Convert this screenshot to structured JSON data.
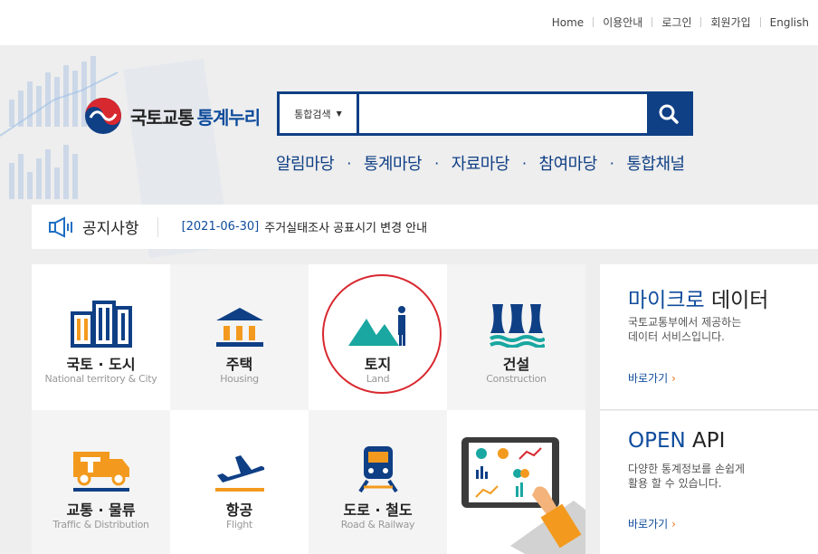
{
  "topnav": {
    "items": [
      "Home",
      "이용안내",
      "로그인",
      "회원가입",
      "English"
    ]
  },
  "logo": {
    "text_prefix": "국토교통",
    "text_highlight": "통계누리"
  },
  "search": {
    "scope_label": "통합검색",
    "query": "",
    "button_icon": "search-icon"
  },
  "mainnav": {
    "items": [
      "알림마당",
      "통계마당",
      "자료마당",
      "참여마당",
      "통합채널"
    ],
    "separator": "·"
  },
  "notice": {
    "title": "공지사항",
    "date": "[2021-06-30]",
    "text": "주거실태조사 공표시기 변경 안내"
  },
  "categories": [
    {
      "kr": "국토 · 도시",
      "en": "National territory & City",
      "icon": "buildings-icon"
    },
    {
      "kr": "주택",
      "en": "Housing",
      "icon": "house-icon"
    },
    {
      "kr": "토지",
      "en": "Land",
      "icon": "mountain-icon"
    },
    {
      "kr": "건설",
      "en": "Construction",
      "icon": "dam-icon"
    },
    {
      "kr": "교통 · 물류",
      "en": "Traffic & Distribution",
      "icon": "truck-icon"
    },
    {
      "kr": "항공",
      "en": "Flight",
      "icon": "airplane-icon"
    },
    {
      "kr": "도로 · 철도",
      "en": "Road & Railway",
      "icon": "train-icon"
    }
  ],
  "side": {
    "micro": {
      "title_hl": "마이크로",
      "title": " 데이터",
      "desc1": "국토교통부에서 제공하는",
      "desc2": "데이터 서비스입니다.",
      "more": "바로가기",
      "arrow": "›"
    },
    "api": {
      "title_hl": "OPEN",
      "title": " API",
      "desc1": "다양한 통계정보를 손쉽게",
      "desc2": "활용 할 수 있습니다.",
      "more": "바로가기",
      "arrow": "›"
    }
  },
  "colors": {
    "navy": "#0f3f85",
    "accent_blue": "#0f4c9c",
    "teal": "#1aa7a1",
    "orange": "#f39a1e",
    "highlight_ring": "#d8282f"
  }
}
